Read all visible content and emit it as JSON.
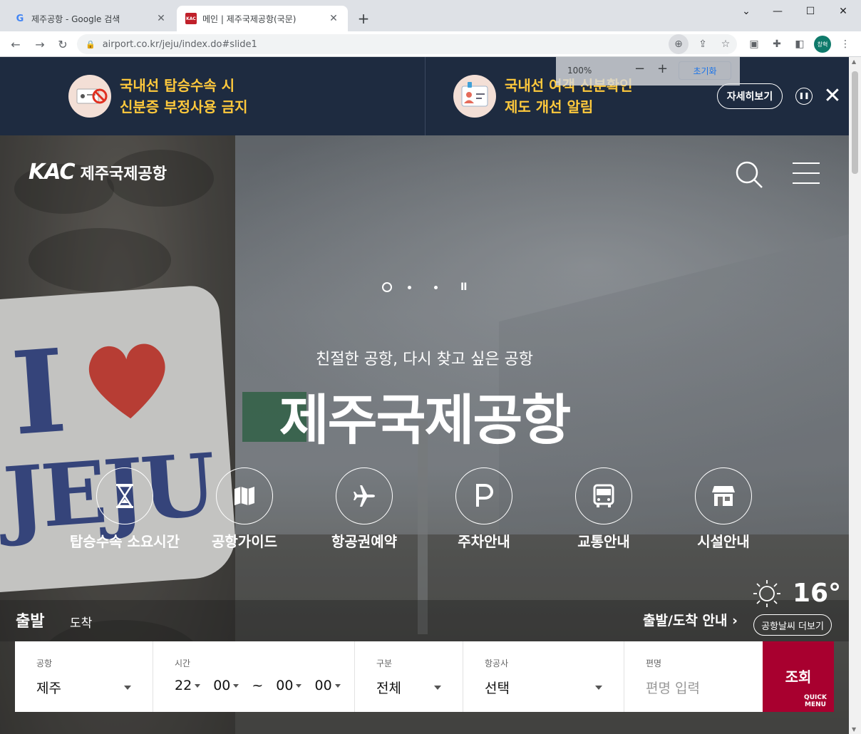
{
  "browser": {
    "tabs": [
      {
        "title": "제주공항 - Google 검색",
        "favicon": "google-icon"
      },
      {
        "title": "메인 | 제주국제공항(국문)",
        "favicon": "kac-favicon"
      }
    ],
    "url": "airport.co.kr/jeju/index.do#slide1",
    "profile_label": "창혁",
    "zoom_popup": {
      "percent": "100%",
      "minus": "−",
      "plus": "+",
      "reset": "초기화"
    }
  },
  "notice": {
    "items": [
      {
        "line1": "국내선 탑승수속 시",
        "line2": "신분증 부정사용 금지"
      },
      {
        "line1": "국내선 여객 신분확인",
        "line2": "제도 개선 알림"
      }
    ],
    "detail_label": "자세히보기",
    "text_color": "#ffc93c",
    "bg_color": "#1e2b40"
  },
  "header": {
    "logo_mark": "KAC",
    "logo_name": "제주국제공항"
  },
  "hero": {
    "slogan": "친절한 공항, 다시 찾고 싶은 공항",
    "title": "제주국제공항",
    "sign_letter": "I",
    "sign_word": "JEJU",
    "slide_current": 1,
    "slide_count": 3
  },
  "quick_menu": [
    {
      "label": "탑승수속 소요시간",
      "icon": "hourglass-icon"
    },
    {
      "label": "공항가이드",
      "icon": "map-icon"
    },
    {
      "label": "항공권예약",
      "icon": "airplane-icon"
    },
    {
      "label": "주차안내",
      "icon": "parking-icon"
    },
    {
      "label": "교통안내",
      "icon": "bus-icon"
    },
    {
      "label": "시설안내",
      "icon": "store-icon"
    }
  ],
  "weather": {
    "icon": "sun-icon",
    "temperature": "16°",
    "more_label": "공항날씨 더보기"
  },
  "flight": {
    "tab_departure": "출발",
    "tab_arrival": "도착",
    "info_link": "출발/도착 안내",
    "airport": {
      "label": "공항",
      "value": "제주"
    },
    "time": {
      "label": "시간",
      "from_hour": "22",
      "from_min": "00",
      "sep": "~",
      "to_hour": "00",
      "to_min": "00"
    },
    "type": {
      "label": "구분",
      "value": "전체"
    },
    "airline": {
      "label": "항공사",
      "value": "선택"
    },
    "flight_no": {
      "label": "편명",
      "placeholder": "편명 입력"
    },
    "submit_label": "조회",
    "quick_menu_label": "QUICK MENU",
    "accent_color": "#a8002f"
  }
}
